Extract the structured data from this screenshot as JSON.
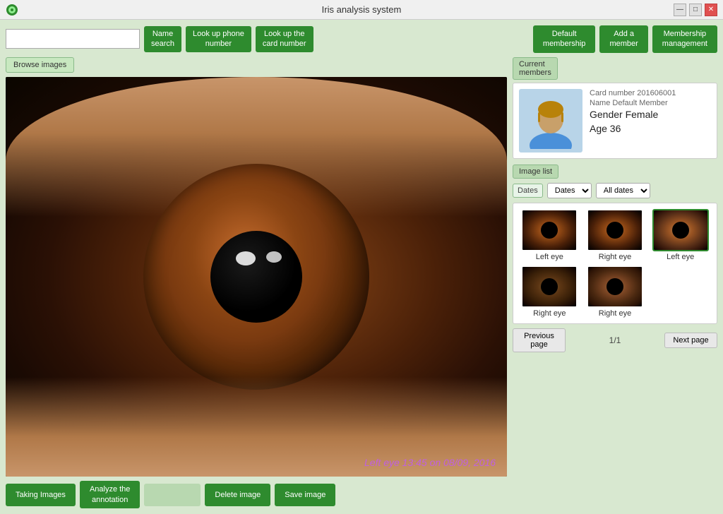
{
  "titlebar": {
    "title": "Iris analysis system",
    "minimize": "—",
    "restore": "□",
    "close": "✕"
  },
  "toolbar": {
    "search_placeholder": "",
    "name_search": "Name\nsearch",
    "lookup_phone": "Look up phone\nnumber",
    "lookup_card": "Look up the\ncard number",
    "default_membership": "Default\nmembership",
    "add_member": "Add a\nmember",
    "membership_mgmt": "Membership\nmanagement"
  },
  "browse": {
    "label": "Browse images"
  },
  "eye_image": {
    "timestamp": "Left eye 13:45 on 08/09, 2016"
  },
  "bottom_toolbar": {
    "taking_images": "Taking Images",
    "analyze": "Analyze the\nannotation",
    "disabled_btn": "",
    "delete": "Delete image",
    "save": "Save image"
  },
  "current_members": {
    "label": "Current\nmembers",
    "card_number": "Card number 201606001",
    "name_label": "Name Default Member",
    "gender": "Gender Female",
    "age": "Age 36"
  },
  "image_list": {
    "label": "Image list",
    "dates_label": "Dates",
    "all_dates": "All dates",
    "thumbnails": [
      {
        "label": "Left eye",
        "selected": false
      },
      {
        "label": "Right eye",
        "selected": false
      },
      {
        "label": "Left eye",
        "selected": true
      },
      {
        "label": "Right eye",
        "selected": false
      },
      {
        "label": "Right eye",
        "selected": false
      }
    ]
  },
  "pagination": {
    "prev": "Previous\npage",
    "indicator": "1/1",
    "next": "Next page"
  }
}
